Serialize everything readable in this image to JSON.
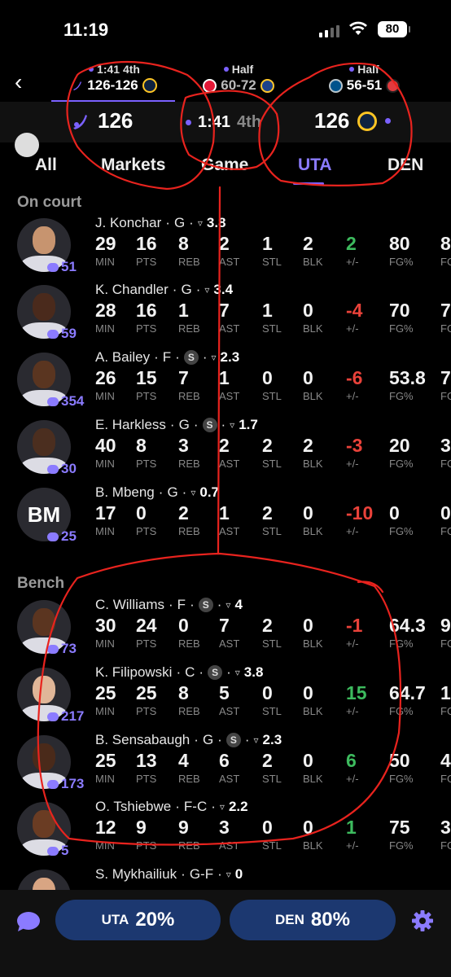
{
  "status": {
    "time": "11:19",
    "battery": "80"
  },
  "games": [
    {
      "status": "1:41 4th",
      "score": "126-126"
    },
    {
      "status": "Half",
      "score": "60-72"
    },
    {
      "status": "Half",
      "score": "56-51"
    }
  ],
  "scorebar": {
    "home_score": "126",
    "clock": "1:41",
    "period": "4th",
    "away_score": "126"
  },
  "tabs": [
    "All",
    "Markets",
    "Game",
    "UTA",
    "DEN"
  ],
  "active_tab": "UTA",
  "sections": {
    "on_court": "On court",
    "bench": "Bench"
  },
  "stat_labels": [
    "MIN",
    "PTS",
    "REB",
    "AST",
    "STL",
    "BLK",
    "+/-",
    "FG%",
    "FG"
  ],
  "players": [
    {
      "name": "J. Konchar",
      "pos": "G",
      "s": false,
      "rating": "3.8",
      "comments": "51",
      "stats": [
        "29",
        "16",
        "8",
        "2",
        "1",
        "2",
        "2",
        "80",
        "8"
      ],
      "pm": "pos"
    },
    {
      "name": "K. Chandler",
      "pos": "G",
      "s": false,
      "rating": "3.4",
      "comments": "59",
      "stats": [
        "28",
        "16",
        "1",
        "7",
        "1",
        "0",
        "-4",
        "70",
        "7"
      ],
      "pm": "neg"
    },
    {
      "name": "A. Bailey",
      "pos": "F",
      "s": true,
      "rating": "2.3",
      "comments": "354",
      "stats": [
        "26",
        "15",
        "7",
        "1",
        "0",
        "0",
        "-6",
        "53.8",
        "7"
      ],
      "pm": "neg"
    },
    {
      "name": "E. Harkless",
      "pos": "G",
      "s": true,
      "rating": "1.7",
      "comments": "30",
      "stats": [
        "40",
        "8",
        "3",
        "2",
        "2",
        "2",
        "-3",
        "20",
        "3"
      ],
      "pm": "neg"
    },
    {
      "name": "B. Mbeng",
      "pos": "G",
      "s": false,
      "rating": "0.7",
      "comments": "25",
      "initials": "BM",
      "stats": [
        "17",
        "0",
        "2",
        "1",
        "2",
        "0",
        "-10",
        "0",
        "0"
      ],
      "pm": "neg"
    },
    {
      "name": "C. Williams",
      "pos": "F",
      "s": true,
      "rating": "4",
      "comments": "73",
      "stats": [
        "30",
        "24",
        "0",
        "7",
        "2",
        "0",
        "-1",
        "64.3",
        "9"
      ],
      "pm": "neg"
    },
    {
      "name": "K. Filipowski",
      "pos": "C",
      "s": true,
      "rating": "3.8",
      "comments": "217",
      "stats": [
        "25",
        "25",
        "8",
        "5",
        "0",
        "0",
        "15",
        "64.7",
        "1"
      ],
      "pm": "pos"
    },
    {
      "name": "B. Sensabaugh",
      "pos": "G",
      "s": true,
      "rating": "2.3",
      "comments": "173",
      "stats": [
        "25",
        "13",
        "4",
        "6",
        "2",
        "0",
        "6",
        "50",
        "4"
      ],
      "pm": "pos"
    },
    {
      "name": "O. Tshiebwe",
      "pos": "F-C",
      "s": false,
      "rating": "2.2",
      "comments": "5",
      "stats": [
        "12",
        "9",
        "9",
        "3",
        "0",
        "0",
        "1",
        "75",
        "3"
      ],
      "pm": "pos"
    },
    {
      "name": "S. Mykhailiuk",
      "pos": "G-F",
      "s": false,
      "rating": "0",
      "comments": "",
      "stats": [],
      "pm": ""
    }
  ],
  "bottom": {
    "uta_label": "UTA",
    "uta_pct": "20%",
    "den_label": "DEN",
    "den_pct": "80%"
  },
  "colors": {
    "accent": "#7b61ff",
    "positive": "#3dbb5e",
    "negative": "#e9423a",
    "annotation": "#e8231e"
  }
}
